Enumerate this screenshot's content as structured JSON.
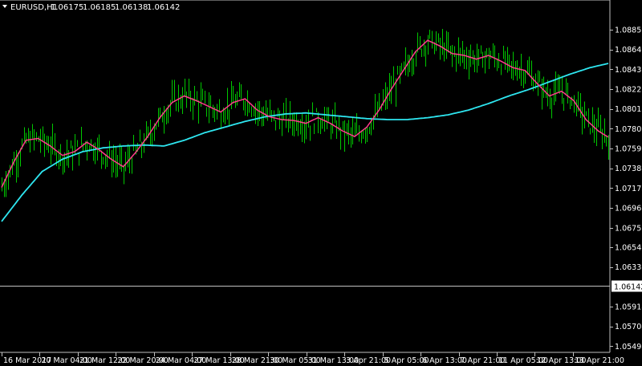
{
  "header": {
    "symbol": "EURUSD,H1",
    "o": "1.06175",
    "h": "1.06185",
    "l": "1.06138",
    "c": "1.06142"
  },
  "chart_data": {
    "type": "line",
    "ylim": [
      1.0545,
      1.0915
    ],
    "y_ticks": [
      "1.08853",
      "1.08643",
      "1.08433",
      "1.08223",
      "1.08013",
      "1.07803",
      "1.07593",
      "1.07383",
      "1.07173",
      "1.06963",
      "1.06753",
      "1.06548",
      "1.06338",
      "1.06128",
      "1.05918",
      "1.05708",
      "1.05498"
    ],
    "x_ticks": [
      "16 Mar 2017",
      "20 Mar 04:00",
      "21 Mar 12:00",
      "22 Mar 20:00",
      "24 Mar 04:00",
      "27 Mar 13:00",
      "28 Mar 21:00",
      "30 Mar 05:00",
      "31 Mar 13:00",
      "3 Apr 21:00",
      "5 Apr 05:00",
      "6 Apr 13:00",
      "7 Apr 21:00",
      "11 Apr 05:00",
      "12 Apr 13:00",
      "13 Apr 21:00"
    ],
    "current_price": 1.06142,
    "current_price_label": "1.06142",
    "bar_count": 300,
    "colors": {
      "bars": "#00c800",
      "fast_ma": "#ff3c8c",
      "slow_ma": "#2ee6f0",
      "price_line": "#c0c0c0",
      "price_tag_bg": "#ffffff"
    },
    "series": [
      {
        "key": "fast_ma",
        "points": [
          [
            0,
            1.0718
          ],
          [
            6,
            1.0745
          ],
          [
            12,
            1.0768
          ],
          [
            18,
            1.077
          ],
          [
            24,
            1.0762
          ],
          [
            30,
            1.0752
          ],
          [
            36,
            1.0756
          ],
          [
            42,
            1.0766
          ],
          [
            48,
            1.0758
          ],
          [
            54,
            1.0748
          ],
          [
            60,
            1.074
          ],
          [
            66,
            1.0755
          ],
          [
            72,
            1.0772
          ],
          [
            78,
            1.0792
          ],
          [
            84,
            1.0808
          ],
          [
            90,
            1.0815
          ],
          [
            96,
            1.081
          ],
          [
            102,
            1.0804
          ],
          [
            108,
            1.0798
          ],
          [
            114,
            1.0808
          ],
          [
            120,
            1.0812
          ],
          [
            126,
            1.08
          ],
          [
            132,
            1.0793
          ],
          [
            138,
            1.079
          ],
          [
            144,
            1.0789
          ],
          [
            150,
            1.0786
          ],
          [
            156,
            1.0792
          ],
          [
            162,
            1.0786
          ],
          [
            168,
            1.0778
          ],
          [
            174,
            1.0772
          ],
          [
            180,
            1.0782
          ],
          [
            186,
            1.08
          ],
          [
            192,
            1.0822
          ],
          [
            198,
            1.0842
          ],
          [
            204,
            1.0862
          ],
          [
            210,
            1.0874
          ],
          [
            216,
            1.0868
          ],
          [
            222,
            1.086
          ],
          [
            228,
            1.0858
          ],
          [
            234,
            1.0854
          ],
          [
            240,
            1.0858
          ],
          [
            246,
            1.0852
          ],
          [
            252,
            1.0845
          ],
          [
            258,
            1.0842
          ],
          [
            264,
            1.0828
          ],
          [
            270,
            1.0815
          ],
          [
            276,
            1.082
          ],
          [
            282,
            1.081
          ],
          [
            288,
            1.079
          ],
          [
            294,
            1.0778
          ],
          [
            300,
            1.077
          ]
        ]
      },
      {
        "key": "slow_ma",
        "points": [
          [
            0,
            1.0682
          ],
          [
            10,
            1.071
          ],
          [
            20,
            1.0735
          ],
          [
            30,
            1.0748
          ],
          [
            40,
            1.0756
          ],
          [
            50,
            1.076
          ],
          [
            60,
            1.0762
          ],
          [
            70,
            1.0763
          ],
          [
            80,
            1.0762
          ],
          [
            90,
            1.0768
          ],
          [
            100,
            1.0776
          ],
          [
            110,
            1.0782
          ],
          [
            120,
            1.0788
          ],
          [
            130,
            1.0793
          ],
          [
            140,
            1.0796
          ],
          [
            150,
            1.0797
          ],
          [
            160,
            1.0795
          ],
          [
            170,
            1.0793
          ],
          [
            180,
            1.0791
          ],
          [
            190,
            1.079
          ],
          [
            200,
            1.079
          ],
          [
            210,
            1.0792
          ],
          [
            220,
            1.0795
          ],
          [
            230,
            1.08
          ],
          [
            240,
            1.0807
          ],
          [
            250,
            1.0815
          ],
          [
            260,
            1.0822
          ],
          [
            270,
            1.083
          ],
          [
            280,
            1.0838
          ],
          [
            290,
            1.0845
          ],
          [
            300,
            1.085
          ]
        ]
      }
    ]
  }
}
